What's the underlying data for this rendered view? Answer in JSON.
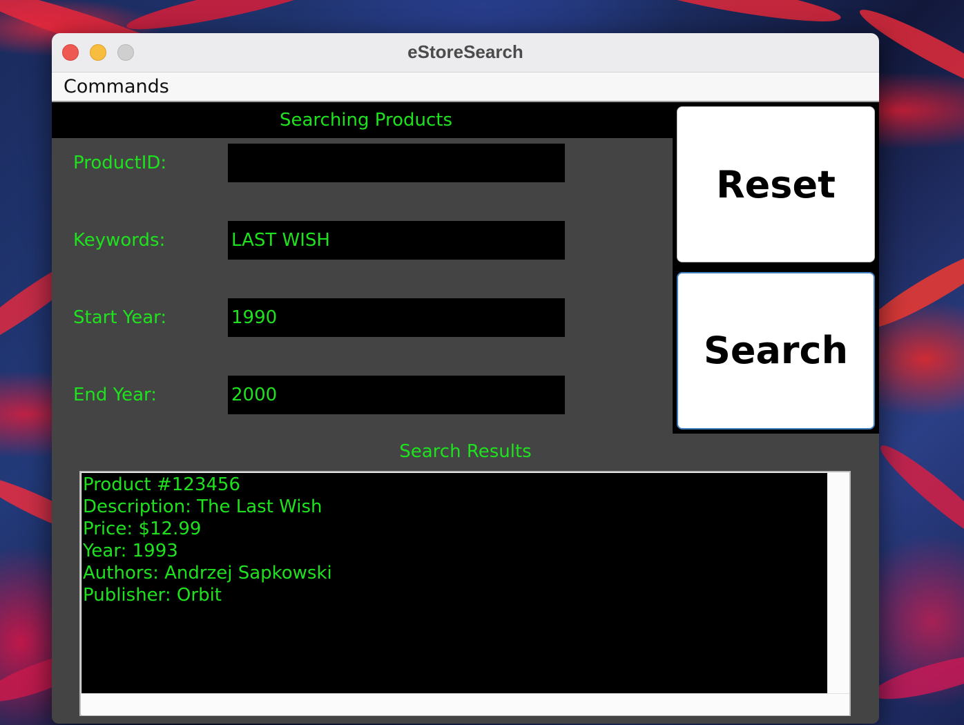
{
  "window": {
    "title": "eStoreSearch"
  },
  "menubar": {
    "items": [
      "Commands"
    ]
  },
  "search_panel": {
    "header": "Searching Products",
    "fields": [
      {
        "label": "ProductID:",
        "value": ""
      },
      {
        "label": "Keywords:",
        "value": "LAST WISH"
      },
      {
        "label": "Start Year:",
        "value": "1990"
      },
      {
        "label": "End Year:",
        "value": "2000"
      }
    ]
  },
  "buttons": {
    "reset": "Reset",
    "search": "Search"
  },
  "results": {
    "label": "Search Results",
    "lines": [
      "Product #123456",
      "Description: The Last Wish",
      "Price: $12.99",
      "Year: 1993",
      "Authors: Andrzej Sapkowski",
      "Publisher: Orbit"
    ]
  },
  "colors": {
    "accent_text": "#1fe21f",
    "panel_bg": "#444444",
    "field_bg": "#000000",
    "focus_border": "#3f7fc4"
  }
}
